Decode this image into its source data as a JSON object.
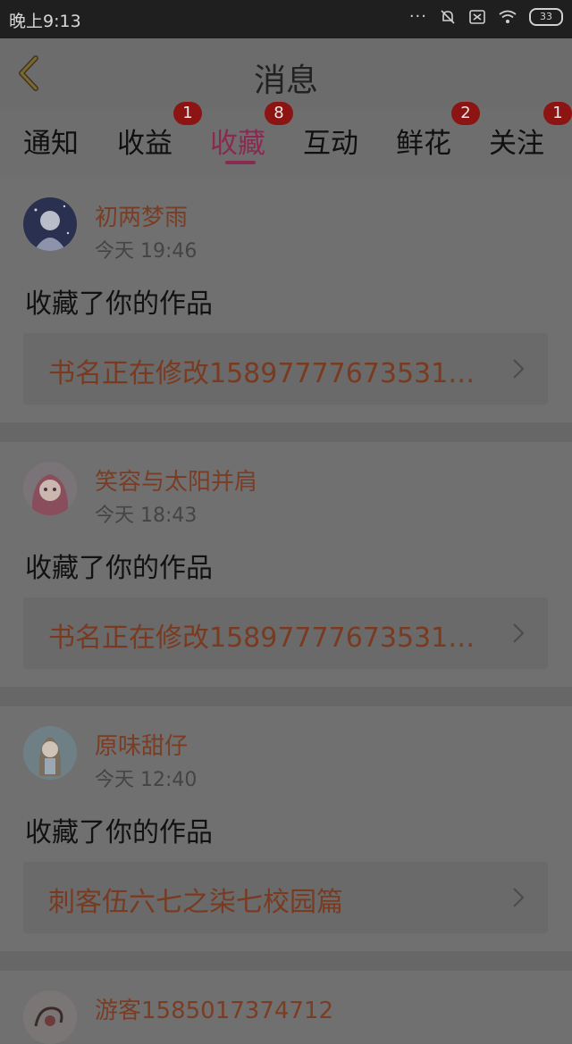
{
  "status_bar": {
    "time": "晚上9:13",
    "battery": "33"
  },
  "header": {
    "title": "消息"
  },
  "tabs": [
    {
      "label": "通知",
      "badge": ""
    },
    {
      "label": "收益",
      "badge": "1"
    },
    {
      "label": "收藏",
      "badge": "8",
      "active": true
    },
    {
      "label": "互动",
      "badge": ""
    },
    {
      "label": "鲜花",
      "badge": "2"
    },
    {
      "label": "关注",
      "badge": "1"
    }
  ],
  "feed": [
    {
      "user": "初两梦雨",
      "time": "今天 19:46",
      "action": "收藏了你的作品",
      "work": "书名正在修改15897777673531…"
    },
    {
      "user": "笑容与太阳并肩",
      "time": "今天 18:43",
      "action": "收藏了你的作品",
      "work": "书名正在修改15897777673531…"
    },
    {
      "user": "原味甜仔",
      "time": "今天 12:40",
      "action": "收藏了你的作品",
      "work": "刺客伍六七之柒七校园篇"
    },
    {
      "user": "游客1585017374712"
    }
  ]
}
